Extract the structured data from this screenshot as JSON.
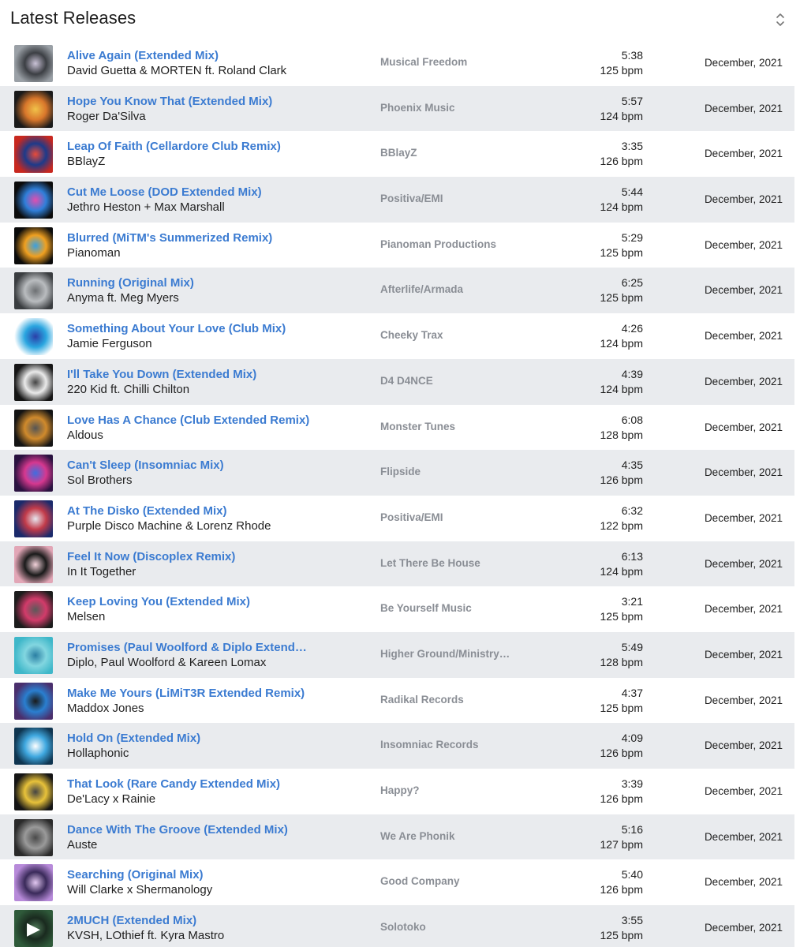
{
  "header": {
    "title": "Latest Releases",
    "sort_icon": "sort-updown-icon"
  },
  "tracks": [
    {
      "title": "Alive Again (Extended Mix)",
      "artist": "David Guetta & MORTEN ft. Roland Clark",
      "label": "Musical Freedom",
      "duration": "5:38",
      "bpm": "125 bpm",
      "date": "December, 2021",
      "art": [
        "#9aa0a6",
        "#3c3f44",
        "#c9c2d6"
      ]
    },
    {
      "title": "Hope You Know That (Extended Mix)",
      "artist": "Roger Da'Silva",
      "label": "Phoenix Music",
      "duration": "5:57",
      "bpm": "124 bpm",
      "date": "December, 2021",
      "art": [
        "#1a1a1a",
        "#d9772b",
        "#f1c24a"
      ]
    },
    {
      "title": "Leap Of Faith (Cellardore Club Remix)",
      "artist": "BBlayZ",
      "label": "BBlayZ",
      "duration": "3:35",
      "bpm": "126 bpm",
      "date": "December, 2021",
      "art": [
        "#c8281f",
        "#1d3a8a",
        "#e84b3a"
      ]
    },
    {
      "title": "Cut Me Loose (DOD Extended Mix)",
      "artist": "Jethro Heston + Max Marshall",
      "label": "Positiva/EMI",
      "duration": "5:44",
      "bpm": "124 bpm",
      "date": "December, 2021",
      "art": [
        "#0b0b0b",
        "#2f7fd9",
        "#e04fb0"
      ]
    },
    {
      "title": "Blurred (MiTM's Summerized Remix)",
      "artist": "Pianoman",
      "label": "Pianoman Productions",
      "duration": "5:29",
      "bpm": "125 bpm",
      "date": "December, 2021",
      "art": [
        "#0b0b0b",
        "#f0a020",
        "#3aa0e0"
      ]
    },
    {
      "title": "Running (Original Mix)",
      "artist": "Anyma ft. Meg Myers",
      "label": "Afterlife/Armada",
      "duration": "6:25",
      "bpm": "125 bpm",
      "date": "December, 2021",
      "art": [
        "#3a3d40",
        "#b9bcbf",
        "#6d7073"
      ]
    },
    {
      "title": "Something About Your Love (Club Mix)",
      "artist": "Jamie Ferguson",
      "label": "Cheeky Trax",
      "duration": "4:26",
      "bpm": "124 bpm",
      "date": "December, 2021",
      "art": [
        "#ffffff",
        "#2aa6e0",
        "#2b3fa8"
      ]
    },
    {
      "title": "I'll Take You Down (Extended Mix)",
      "artist": "220 Kid ft. Chilli Chilton",
      "label": "D4 D4NCE",
      "duration": "4:39",
      "bpm": "124 bpm",
      "date": "December, 2021",
      "art": [
        "#151515",
        "#eaeaea",
        "#444444"
      ]
    },
    {
      "title": "Love Has A Chance (Club Extended Remix)",
      "artist": "Aldous",
      "label": "Monster Tunes",
      "duration": "6:08",
      "bpm": "128 bpm",
      "date": "December, 2021",
      "art": [
        "#141414",
        "#d08a2c",
        "#555555"
      ]
    },
    {
      "title": "Can't Sleep (Insomniac Mix)",
      "artist": "Sol Brothers",
      "label": "Flipside",
      "duration": "4:35",
      "bpm": "126 bpm",
      "date": "December, 2021",
      "art": [
        "#2a1240",
        "#d6388f",
        "#3f6de0"
      ]
    },
    {
      "title": "At The Disko (Extended Mix)",
      "artist": "Purple Disco Machine & Lorenz Rhode",
      "label": "Positiva/EMI",
      "duration": "6:32",
      "bpm": "122 bpm",
      "date": "December, 2021",
      "art": [
        "#1b2a6b",
        "#c23b4a",
        "#e7e7ef"
      ]
    },
    {
      "title": "Feel It Now (Discoplex Remix)",
      "artist": "In It Together",
      "label": "Let There Be House",
      "duration": "6:13",
      "bpm": "124 bpm",
      "date": "December, 2021",
      "art": [
        "#e2a6b6",
        "#1a1a1a",
        "#f3d2da"
      ]
    },
    {
      "title": "Keep Loving You (Extended Mix)",
      "artist": "Melsen",
      "label": "Be Yourself Music",
      "duration": "3:21",
      "bpm": "125 bpm",
      "date": "December, 2021",
      "art": [
        "#1c1c1c",
        "#d23b6a",
        "#5a5a5a"
      ]
    },
    {
      "title": "Promises (Paul Woolford & Diplo Extended Remix)",
      "artist": "Diplo, Paul Woolford & Kareen Lomax",
      "label": "Higher Ground/Ministry of Sound",
      "duration": "5:49",
      "bpm": "128 bpm",
      "date": "December, 2021",
      "art": [
        "#3fb7c9",
        "#82d6e0",
        "#2b7fa3"
      ]
    },
    {
      "title": "Make Me Yours (LiMiT3R Extended Remix)",
      "artist": "Maddox Jones",
      "label": "Radikal Records",
      "duration": "4:37",
      "bpm": "125 bpm",
      "date": "December, 2021",
      "art": [
        "#4a2f6d",
        "#2a7fd0",
        "#1a1a1a"
      ]
    },
    {
      "title": "Hold On (Extended Mix)",
      "artist": "Hollaphonic",
      "label": "Insomniac Records",
      "duration": "4:09",
      "bpm": "126 bpm",
      "date": "December, 2021",
      "art": [
        "#0f3550",
        "#3fa8e0",
        "#ffffff"
      ]
    },
    {
      "title": "That Look (Rare Candy Extended Mix)",
      "artist": "De'Lacy x Rainie",
      "label": "Happy?",
      "duration": "3:39",
      "bpm": "126 bpm",
      "date": "December, 2021",
      "art": [
        "#151515",
        "#e8c23a",
        "#444444"
      ]
    },
    {
      "title": "Dance With The Groove (Extended Mix)",
      "artist": "Auste",
      "label": "We Are Phonik",
      "duration": "5:16",
      "bpm": "127 bpm",
      "date": "December, 2021",
      "art": [
        "#2a2a2a",
        "#9a9a9a",
        "#4a4a4a"
      ]
    },
    {
      "title": "Searching (Original Mix)",
      "artist": "Will Clarke x Shermanology",
      "label": "Good Company",
      "duration": "5:40",
      "bpm": "126 bpm",
      "date": "December, 2021",
      "art": [
        "#b78ad9",
        "#3a2a5a",
        "#e2c7f0"
      ]
    },
    {
      "title": "2MUCH (Extended Mix)",
      "artist": "KVSH, LOthief ft. Kyra Mastro",
      "label": "Solotoko",
      "duration": "3:55",
      "bpm": "125 bpm",
      "date": "December, 2021",
      "art": [
        "#2f5a3a",
        "#1a2a1f",
        "#4f7a58"
      ],
      "playing": true
    }
  ]
}
